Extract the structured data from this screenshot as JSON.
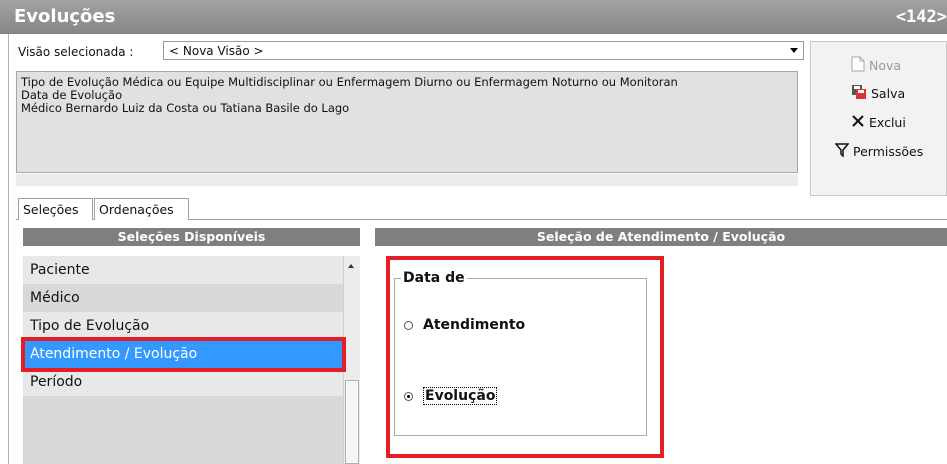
{
  "window": {
    "title": "Evoluções",
    "code": "<142>"
  },
  "view": {
    "label": "Visão selecionada  :",
    "selected": "< Nova Visão >"
  },
  "criteria": [
    "Tipo de Evolução Médica ou Equipe Multidisciplinar ou Enfermagem Diurno ou Enfermagem Noturno ou Monitoran",
    "Data de Evolução",
    "Médico Bernardo Luiz da Costa ou Tatiana Basile do Lago"
  ],
  "actions": {
    "new": "Nova",
    "save": "Salva",
    "delete": "Exclui",
    "permissions": "Permissões"
  },
  "tabs": [
    "Seleções",
    "Ordenações"
  ],
  "left_panel": {
    "header": "Seleções Disponíveis",
    "items": [
      "Paciente",
      "Médico",
      "Tipo de Evolução",
      "Atendimento / Evolução",
      "Período"
    ],
    "selected_index": 3
  },
  "right_panel": {
    "header": "Seleção de Atendimento / Evolução",
    "group_title": "Data de",
    "options": [
      "Atendimento",
      "Evolução"
    ],
    "selected_option": 1
  },
  "colors": {
    "highlight_red": "#e31e24",
    "selection_blue": "#3399ff",
    "header_gray": "#7f7f7f"
  }
}
